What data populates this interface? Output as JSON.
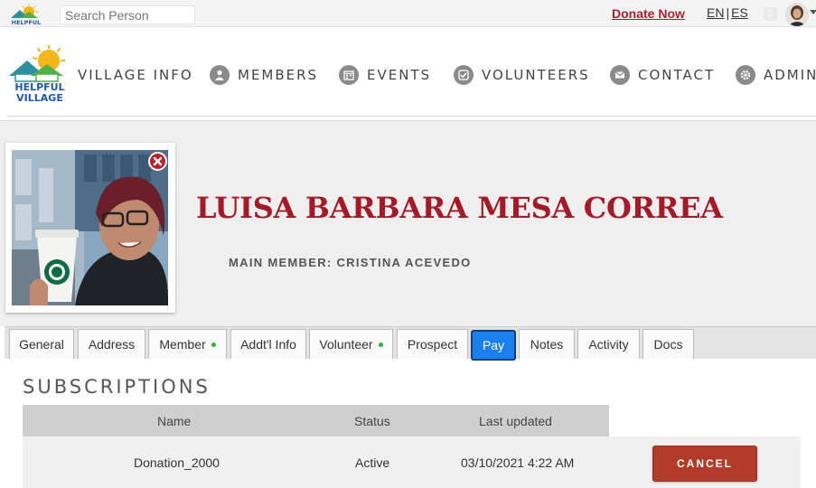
{
  "topbar": {
    "search_placeholder": "Search Person",
    "donate_label": "Donate Now",
    "lang_en": "EN",
    "lang_sep": "|",
    "lang_es": "ES",
    "notification_count": "0"
  },
  "logo": {
    "line1": "HELPFUL",
    "line2": "VILLAGE"
  },
  "nav": {
    "items": [
      {
        "label": "VILLAGE INFO"
      },
      {
        "label": "MEMBERS",
        "icon": "person-icon"
      },
      {
        "label": "EVENTS",
        "icon": "calendar-icon"
      },
      {
        "label": "VOLUNTEERS",
        "icon": "check-icon"
      },
      {
        "label": "CONTACT",
        "icon": "envelope-icon"
      },
      {
        "label": "ADMIN",
        "icon": "gear-icon"
      }
    ]
  },
  "profile": {
    "name": "LUISA BARBARA MESA CORREA",
    "main_member": "MAIN MEMBER: CRISTINA ACEVEDO"
  },
  "tabs": [
    {
      "label": "General"
    },
    {
      "label": "Address"
    },
    {
      "label": "Member",
      "dot": true
    },
    {
      "label": "Addt'l Info"
    },
    {
      "label": "Volunteer",
      "dot": true
    },
    {
      "label": "Prospect"
    },
    {
      "label": "Pay",
      "active": true
    },
    {
      "label": "Notes"
    },
    {
      "label": "Activity"
    },
    {
      "label": "Docs"
    }
  ],
  "subscriptions": {
    "title": "SUBSCRIPTIONS",
    "columns": [
      "Name",
      "Status",
      "Last updated"
    ],
    "rows": [
      {
        "name": "Donation_2000",
        "status": "Active",
        "last_updated": "03/10/2021 4:22 AM",
        "action": "CANCEL"
      }
    ]
  },
  "colors": {
    "accent_red": "#a51a26",
    "active_tab": "#1a80f0",
    "cancel_button": "#b33b2a",
    "status_dot": "#2bb03b"
  }
}
